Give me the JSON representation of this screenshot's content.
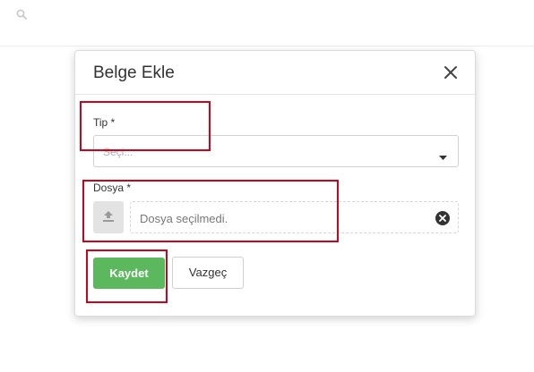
{
  "modal": {
    "title": "Belge Ekle",
    "type_field": {
      "label": "Tip *",
      "placeholder": "Seçi..."
    },
    "file_field": {
      "label": "Dosya *",
      "status_text": "Dosya seçilmedi."
    },
    "buttons": {
      "save_label": "Kaydet",
      "cancel_label": "Vazgeç"
    }
  },
  "icons": {
    "search": "search-icon",
    "close": "close-icon",
    "caret": "caret-down-icon",
    "upload": "upload-icon",
    "clear": "clear-icon"
  },
  "colors": {
    "save_button": "#5cb85c",
    "annotation_box": "#d0021b",
    "upload_button_bg": "#e3e3e3"
  }
}
